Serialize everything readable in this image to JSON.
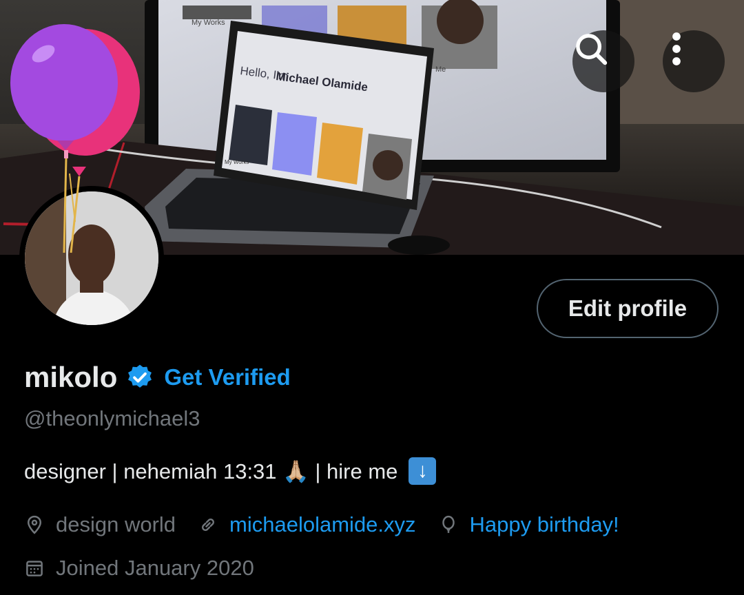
{
  "header": {
    "laptop_screen_greeting": "Hello, I'm",
    "laptop_screen_name": "Michael Olamide",
    "monitor_label_works": "My Works",
    "monitor_label_me": "Me",
    "laptop_label_works": "My Works"
  },
  "actions": {
    "search_icon": "search-icon",
    "more_icon": "more-vertical-icon",
    "edit_profile_label": "Edit profile"
  },
  "profile": {
    "display_name": "mikolo",
    "verified_badge": "verified-badge-icon",
    "get_verified_label": "Get Verified",
    "handle": "@theonlymichael3",
    "bio_text": "designer | nehemiah 13:31 🙏🏼 | hire me",
    "bio_emoji": "⬇️",
    "location": "design world",
    "website": "michaelolamide.xyz",
    "birthday": "Happy birthday!",
    "joined": "Joined January 2020"
  },
  "colors": {
    "accent": "#1d9bf0",
    "muted": "#71767b",
    "text": "#e7e9ea",
    "border": "#536471",
    "balloon_pink": "#e8327a",
    "balloon_purple": "#a34ae0"
  }
}
